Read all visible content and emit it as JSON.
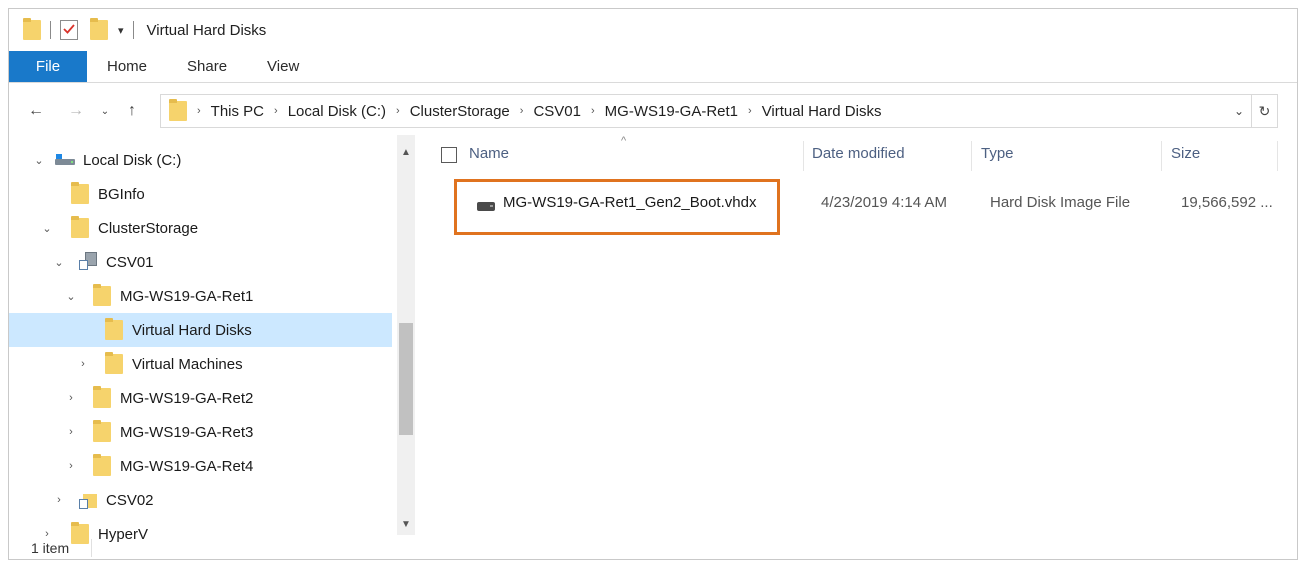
{
  "window": {
    "title": "Virtual Hard Disks"
  },
  "ribbon": {
    "tabs": [
      "File",
      "Home",
      "Share",
      "View"
    ]
  },
  "address": {
    "crumbs": [
      "This PC",
      "Local Disk (C:)",
      "ClusterStorage",
      "CSV01",
      "MG-WS19-GA-Ret1",
      "Virtual Hard Disks"
    ]
  },
  "tree": {
    "items": [
      {
        "label": "Local Disk (C:)",
        "icon": "drive-icon",
        "chevron": "expanded"
      },
      {
        "label": "BGInfo",
        "icon": "folder-icon",
        "chevron": "none"
      },
      {
        "label": "ClusterStorage",
        "icon": "folder-icon",
        "chevron": "expanded"
      },
      {
        "label": "CSV01",
        "icon": "cluster-volume-icon",
        "chevron": "expanded"
      },
      {
        "label": "MG-WS19-GA-Ret1",
        "icon": "folder-icon",
        "chevron": "expanded"
      },
      {
        "label": "Virtual Hard Disks",
        "icon": "folder-icon",
        "chevron": "none",
        "selected": true
      },
      {
        "label": "Virtual Machines",
        "icon": "folder-icon",
        "chevron": "collapsed"
      },
      {
        "label": "MG-WS19-GA-Ret2",
        "icon": "folder-icon",
        "chevron": "collapsed"
      },
      {
        "label": "MG-WS19-GA-Ret3",
        "icon": "folder-icon",
        "chevron": "collapsed"
      },
      {
        "label": "MG-WS19-GA-Ret4",
        "icon": "folder-icon",
        "chevron": "collapsed"
      },
      {
        "label": "CSV02",
        "icon": "cluster-volume-icon",
        "chevron": "collapsed"
      },
      {
        "label": "HyperV",
        "icon": "folder-icon",
        "chevron": "collapsed"
      }
    ]
  },
  "columns": {
    "name": "Name",
    "date": "Date modified",
    "type": "Type",
    "size": "Size"
  },
  "files": [
    {
      "name": "MG-WS19-GA-Ret1_Gen2_Boot.vhdx",
      "date": "4/23/2019 4:14 AM",
      "type": "Hard Disk Image File",
      "size": "19,566,592 ...",
      "icon": "hard-disk-image-icon",
      "highlighted": true
    }
  ],
  "status": {
    "item_count": "1 item"
  },
  "colors": {
    "file_tab": "#1979ca",
    "selection": "#cce8ff",
    "highlight_box": "#e0731f",
    "header_text": "#4d6082"
  }
}
